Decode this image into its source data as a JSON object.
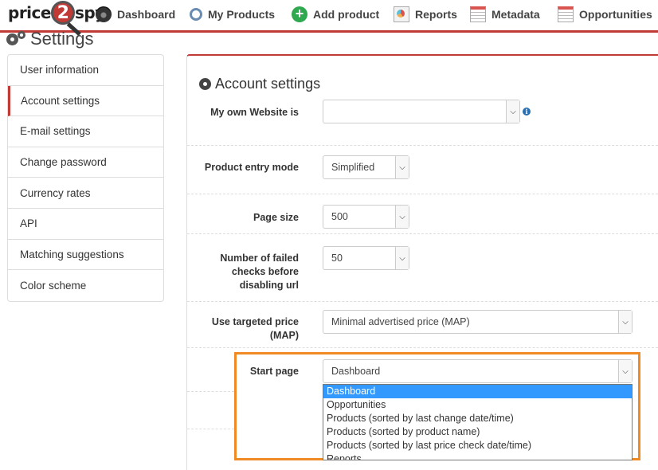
{
  "app": {
    "logo_left": "price",
    "logo_mid": "2",
    "logo_right": "spy"
  },
  "nav": {
    "items": [
      {
        "label": "Dashboard",
        "icon": "dashboard-icon"
      },
      {
        "label": "My Products",
        "icon": "search-icon"
      },
      {
        "label": "Add product",
        "icon": "add-icon"
      },
      {
        "label": "Reports",
        "icon": "reports-icon"
      },
      {
        "label": "Metadata",
        "icon": "metadata-icon"
      },
      {
        "label": "Opportunities",
        "icon": "opportunities-icon"
      }
    ],
    "accent_color": "#c23a36"
  },
  "page": {
    "title": "Settings"
  },
  "sidebar": {
    "items": [
      {
        "label": "User information"
      },
      {
        "label": "Account settings",
        "active": true
      },
      {
        "label": "E-mail settings"
      },
      {
        "label": "Change password"
      },
      {
        "label": "Currency rates"
      },
      {
        "label": "API"
      },
      {
        "label": "Matching suggestions"
      },
      {
        "label": "Color scheme"
      }
    ]
  },
  "account": {
    "title": "Account settings",
    "fields": {
      "website": {
        "label": "My own Website is",
        "value": ""
      },
      "entry_mode": {
        "label": "Product entry mode",
        "value": "Simplified"
      },
      "page_size": {
        "label": "Page size",
        "value": "500"
      },
      "failed_checks": {
        "label": "Number of failed checks before disabling url",
        "value": "50"
      },
      "map": {
        "label": "Use targeted price (MAP)",
        "value": "Minimal advertised price (MAP)"
      },
      "start_page": {
        "label": "Start page",
        "value": "Dashboard"
      }
    },
    "start_page_options": [
      "Dashboard",
      "Opportunities",
      "Products (sorted by last change date/time)",
      "Products (sorted by product name)",
      "Products (sorted by last price check date/time)",
      "Reports"
    ],
    "highlight_color": "#f08a24"
  }
}
